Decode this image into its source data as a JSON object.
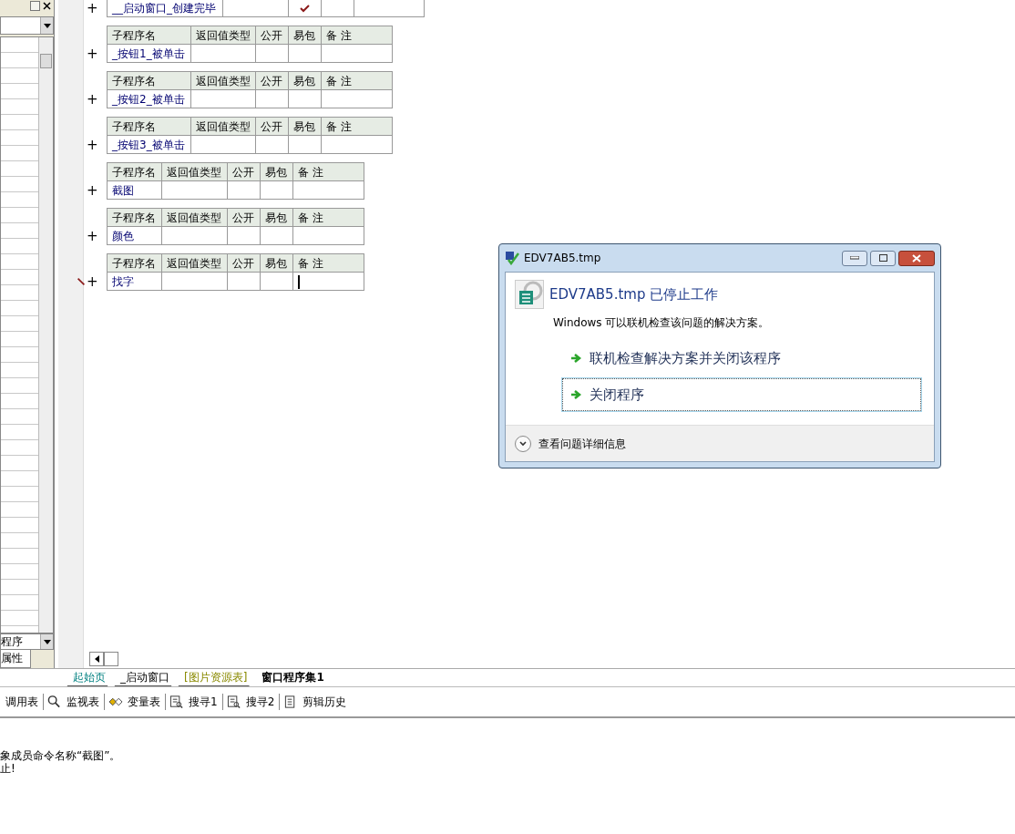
{
  "left_panel": {
    "bottom_dropdown": {
      "value": "程序"
    },
    "tab": {
      "label": "属性"
    }
  },
  "subroutines": [
    {
      "name": "__启动窗口_创建完毕",
      "public": true,
      "editing": false,
      "cursor": false
    },
    {
      "name": "_按钮1_被单击",
      "public": false,
      "headers": [
        "子程序名",
        "返回值类型",
        "公开",
        "易包",
        "备 注"
      ],
      "editing": false,
      "cursor": false
    },
    {
      "name": "_按钮2_被单击",
      "public": false,
      "headers": [
        "子程序名",
        "返回值类型",
        "公开",
        "易包",
        "备 注"
      ],
      "editing": false,
      "cursor": false
    },
    {
      "name": "_按钮3_被单击",
      "public": false,
      "headers": [
        "子程序名",
        "返回值类型",
        "公开",
        "易包",
        "备 注"
      ],
      "editing": false,
      "cursor": false
    },
    {
      "name": "截图",
      "public": false,
      "headers": [
        "子程序名",
        "返回值类型",
        "公开",
        "易包",
        "备 注"
      ],
      "editing": false,
      "cursor": false
    },
    {
      "name": "颜色",
      "public": false,
      "headers": [
        "子程序名",
        "返回值类型",
        "公开",
        "易包",
        "备 注"
      ],
      "editing": false,
      "cursor": false
    },
    {
      "name": "找字",
      "public": false,
      "headers": [
        "子程序名",
        "返回值类型",
        "公开",
        "易包",
        "备 注"
      ],
      "editing": true,
      "cursor": true
    }
  ],
  "expand_sign": "+",
  "editor_tabs": [
    {
      "label": "起始页",
      "kind": "start",
      "selected": false
    },
    {
      "label": "_启动窗口",
      "kind": "window",
      "selected": false
    },
    {
      "label": "[图片资源表]",
      "kind": "resource",
      "selected": false
    },
    {
      "label": "窗口程序集1",
      "kind": "code",
      "selected": true
    }
  ],
  "toolbar": [
    {
      "label": "调用表",
      "kind": "plain"
    },
    {
      "label": "监视表",
      "kind": "watch"
    },
    {
      "label": "变量表",
      "kind": "variables"
    },
    {
      "label": "搜寻1",
      "kind": "find"
    },
    {
      "label": "搜寻2",
      "kind": "find"
    },
    {
      "label": "剪辑历史",
      "kind": "history"
    }
  ],
  "output": [
    "象成员命令名称“截图”。",
    "止!"
  ],
  "dialog": {
    "title": "EDV7AB5.tmp",
    "heading": "EDV7AB5.tmp 已停止工作",
    "message": "Windows 可以联机检查该问题的解决方案。",
    "options": [
      {
        "label": "联机检查解决方案并关闭该程序",
        "selected": false
      },
      {
        "label": "关闭程序",
        "selected": true
      }
    ],
    "details": "查看问题详细信息"
  }
}
